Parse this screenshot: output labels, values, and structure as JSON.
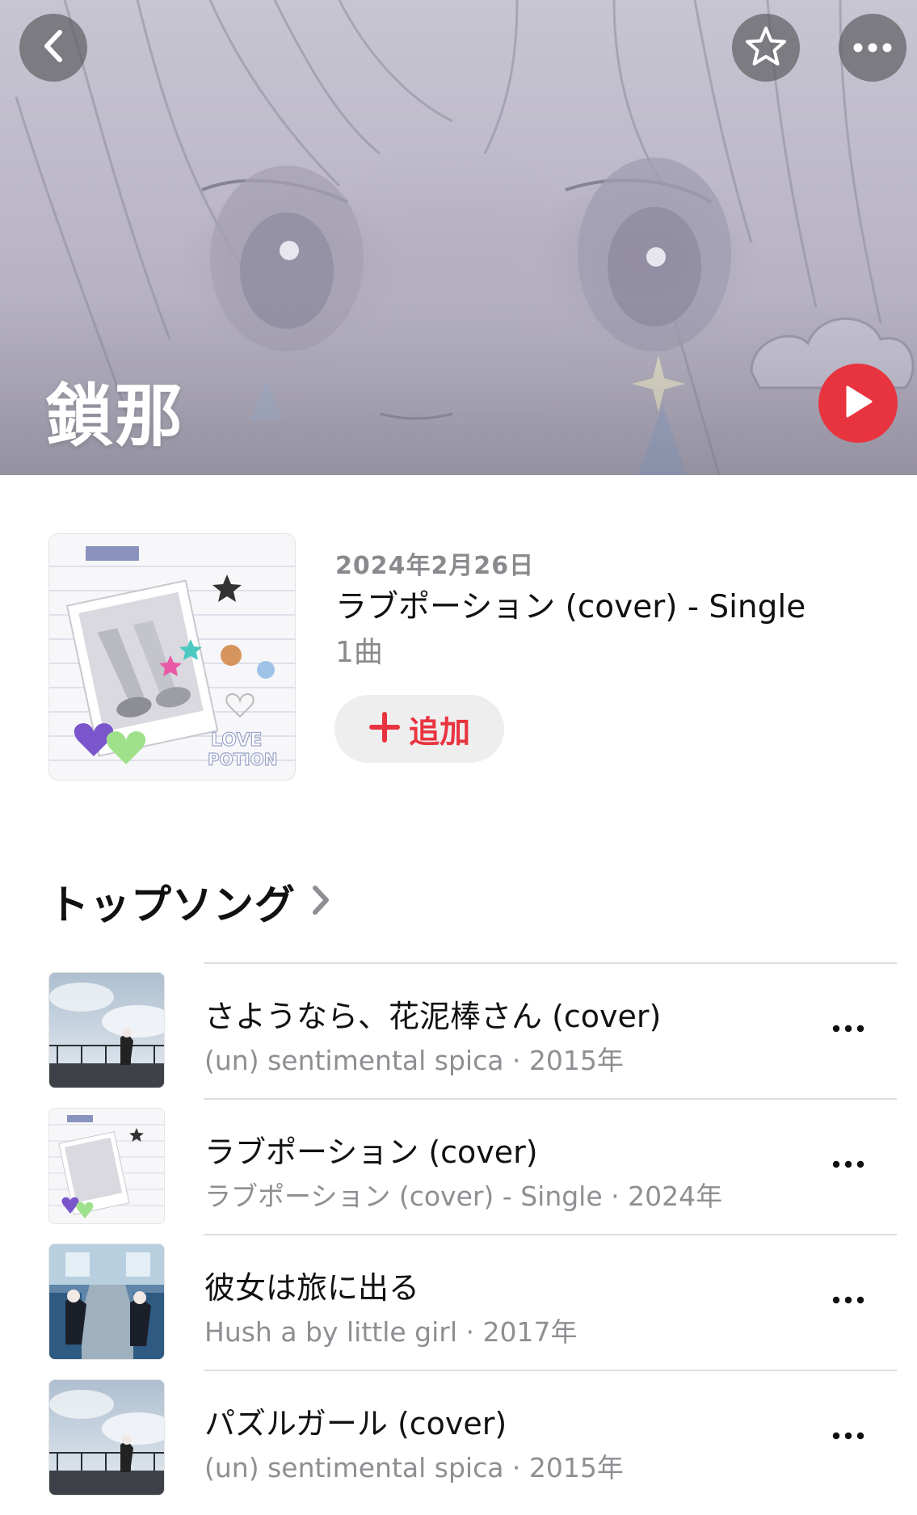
{
  "artist": {
    "name": "鎖那"
  },
  "header": {
    "back_icon": "chevron-left-icon",
    "favorite_icon": "star-icon",
    "more_icon": "ellipsis-icon",
    "play_icon": "play-icon"
  },
  "latest_release": {
    "date": "2024年2月26日",
    "title": "ラブポーション (cover) - Single",
    "track_count": "1曲",
    "add_label": "追加",
    "art_text": [
      "LOVE",
      "POTION"
    ]
  },
  "top_songs": {
    "title": "トップソング",
    "items": [
      {
        "title": "さようなら、花泥棒さん (cover)",
        "subtitle": "(un) sentimental spica · 2015年"
      },
      {
        "title": "ラブポーション (cover)",
        "subtitle": "ラブポーション (cover) - Single · 2024年"
      },
      {
        "title": "彼女は旅に出る",
        "subtitle": "Hush a by little girl · 2017年"
      },
      {
        "title": "パズルガール (cover)",
        "subtitle": "(un) sentimental spica · 2015年"
      }
    ]
  },
  "colors": {
    "accent": "#e8343f",
    "secondary_text": "#8e8e93",
    "hero_overlay_button": "#5f5f64"
  }
}
